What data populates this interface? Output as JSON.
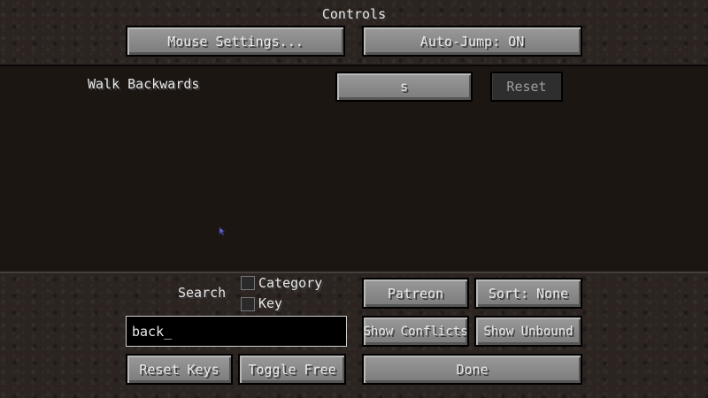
{
  "title": "Controls",
  "top_buttons": {
    "mouse_settings": "Mouse Settings...",
    "auto_jump": "Auto-Jump: ON"
  },
  "keybinds": [
    {
      "label": "Walk Backwards",
      "key": "s",
      "reset": "Reset"
    }
  ],
  "search": {
    "label": "Search",
    "value": "back_",
    "options": {
      "category": "Category",
      "key": "Key"
    }
  },
  "bottom_buttons": {
    "patreon": "Patreon",
    "sort": "Sort: None",
    "show_conflicts": "Show Conflicts",
    "show_unbound": "Show Unbound",
    "reset_keys": "Reset Keys",
    "toggle_free": "Toggle Free",
    "done": "Done"
  },
  "colors": {
    "background": "#2b2421",
    "list_panel": "#1c1613",
    "button": "#8b8b8b",
    "text": "#e8e8e8"
  }
}
